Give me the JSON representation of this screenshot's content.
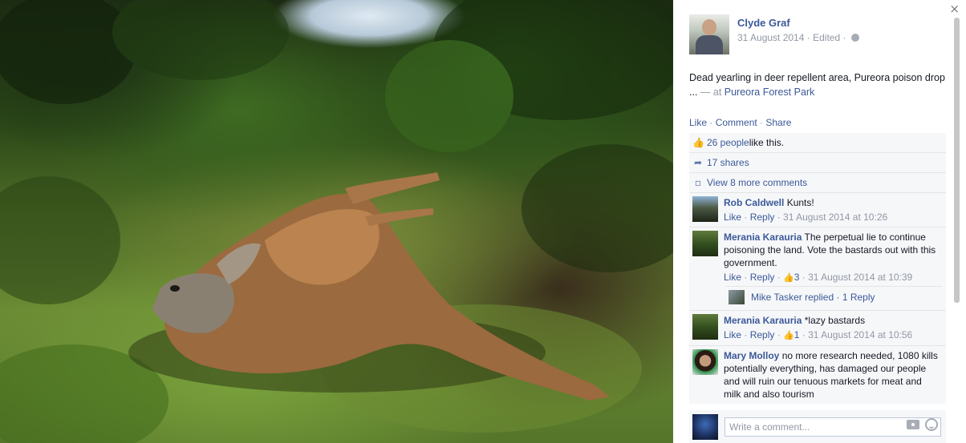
{
  "post": {
    "author": "Clyde Graf",
    "date": "31 August 2014",
    "edited": "Edited",
    "caption_text": "Dead yearling in deer repellent area, Pureora poison drop ...",
    "caption_at": " — at ",
    "place": "Pureora Forest Park",
    "photo_alt": "Dead yearling deer lying on grass in forest clearing"
  },
  "actions": {
    "like": "Like",
    "comment": "Comment",
    "share": "Share",
    "sep": " · "
  },
  "ufi": {
    "likes_count": "26 people",
    "likes_suffix": " like this.",
    "shares": "17 shares",
    "more_comments": "View 8 more comments"
  },
  "comments": [
    {
      "name": "Rob Caldwell",
      "text": "Kunts!",
      "like": "Like",
      "reply": "Reply",
      "time": "31 August 2014 at 10:26"
    },
    {
      "name": "Merania Karauria",
      "text": "The perpetual lie to continue poisoning the land. Vote the bastards out with this government.",
      "like": "Like",
      "reply": "Reply",
      "likes": "3",
      "time": "31 August 2014 at 10:39",
      "replied": "Mike Tasker replied",
      "replied_count": "1 Reply"
    },
    {
      "name": "Merania Karauria",
      "text": "*lazy bastards",
      "like": "Like",
      "reply": "Reply",
      "likes": "1",
      "time": "31 August 2014 at 10:56"
    },
    {
      "name": "Mary Molloy",
      "text": "no more research needed, 1080 kills potentially everything, has damaged our people and will ruin our tenuous markets for meat and milk and also tourism"
    }
  ],
  "compose": {
    "placeholder": "Write a comment..."
  },
  "close": "×",
  "colors": {
    "link": "#3b5998",
    "muted": "#9197a3",
    "ufi_bg": "#f6f7f9"
  },
  "icons": [
    "close-icon",
    "globe-icon",
    "thumbs-up-icon",
    "share-icon",
    "comment-icon",
    "camera-icon",
    "smiley-icon"
  ]
}
